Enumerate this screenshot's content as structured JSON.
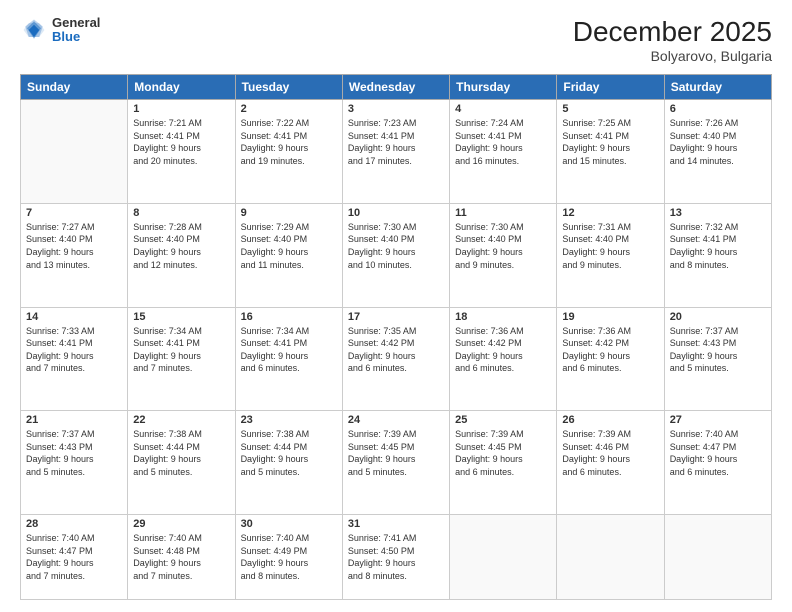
{
  "logo": {
    "line1": "General",
    "line2": "Blue"
  },
  "title": "December 2025",
  "location": "Bolyarovo, Bulgaria",
  "weekdays": [
    "Sunday",
    "Monday",
    "Tuesday",
    "Wednesday",
    "Thursday",
    "Friday",
    "Saturday"
  ],
  "weeks": [
    [
      {
        "day": "",
        "info": ""
      },
      {
        "day": "1",
        "info": "Sunrise: 7:21 AM\nSunset: 4:41 PM\nDaylight: 9 hours\nand 20 minutes."
      },
      {
        "day": "2",
        "info": "Sunrise: 7:22 AM\nSunset: 4:41 PM\nDaylight: 9 hours\nand 19 minutes."
      },
      {
        "day": "3",
        "info": "Sunrise: 7:23 AM\nSunset: 4:41 PM\nDaylight: 9 hours\nand 17 minutes."
      },
      {
        "day": "4",
        "info": "Sunrise: 7:24 AM\nSunset: 4:41 PM\nDaylight: 9 hours\nand 16 minutes."
      },
      {
        "day": "5",
        "info": "Sunrise: 7:25 AM\nSunset: 4:41 PM\nDaylight: 9 hours\nand 15 minutes."
      },
      {
        "day": "6",
        "info": "Sunrise: 7:26 AM\nSunset: 4:40 PM\nDaylight: 9 hours\nand 14 minutes."
      }
    ],
    [
      {
        "day": "7",
        "info": "Sunrise: 7:27 AM\nSunset: 4:40 PM\nDaylight: 9 hours\nand 13 minutes."
      },
      {
        "day": "8",
        "info": "Sunrise: 7:28 AM\nSunset: 4:40 PM\nDaylight: 9 hours\nand 12 minutes."
      },
      {
        "day": "9",
        "info": "Sunrise: 7:29 AM\nSunset: 4:40 PM\nDaylight: 9 hours\nand 11 minutes."
      },
      {
        "day": "10",
        "info": "Sunrise: 7:30 AM\nSunset: 4:40 PM\nDaylight: 9 hours\nand 10 minutes."
      },
      {
        "day": "11",
        "info": "Sunrise: 7:30 AM\nSunset: 4:40 PM\nDaylight: 9 hours\nand 9 minutes."
      },
      {
        "day": "12",
        "info": "Sunrise: 7:31 AM\nSunset: 4:40 PM\nDaylight: 9 hours\nand 9 minutes."
      },
      {
        "day": "13",
        "info": "Sunrise: 7:32 AM\nSunset: 4:41 PM\nDaylight: 9 hours\nand 8 minutes."
      }
    ],
    [
      {
        "day": "14",
        "info": "Sunrise: 7:33 AM\nSunset: 4:41 PM\nDaylight: 9 hours\nand 7 minutes."
      },
      {
        "day": "15",
        "info": "Sunrise: 7:34 AM\nSunset: 4:41 PM\nDaylight: 9 hours\nand 7 minutes."
      },
      {
        "day": "16",
        "info": "Sunrise: 7:34 AM\nSunset: 4:41 PM\nDaylight: 9 hours\nand 6 minutes."
      },
      {
        "day": "17",
        "info": "Sunrise: 7:35 AM\nSunset: 4:42 PM\nDaylight: 9 hours\nand 6 minutes."
      },
      {
        "day": "18",
        "info": "Sunrise: 7:36 AM\nSunset: 4:42 PM\nDaylight: 9 hours\nand 6 minutes."
      },
      {
        "day": "19",
        "info": "Sunrise: 7:36 AM\nSunset: 4:42 PM\nDaylight: 9 hours\nand 6 minutes."
      },
      {
        "day": "20",
        "info": "Sunrise: 7:37 AM\nSunset: 4:43 PM\nDaylight: 9 hours\nand 5 minutes."
      }
    ],
    [
      {
        "day": "21",
        "info": "Sunrise: 7:37 AM\nSunset: 4:43 PM\nDaylight: 9 hours\nand 5 minutes."
      },
      {
        "day": "22",
        "info": "Sunrise: 7:38 AM\nSunset: 4:44 PM\nDaylight: 9 hours\nand 5 minutes."
      },
      {
        "day": "23",
        "info": "Sunrise: 7:38 AM\nSunset: 4:44 PM\nDaylight: 9 hours\nand 5 minutes."
      },
      {
        "day": "24",
        "info": "Sunrise: 7:39 AM\nSunset: 4:45 PM\nDaylight: 9 hours\nand 5 minutes."
      },
      {
        "day": "25",
        "info": "Sunrise: 7:39 AM\nSunset: 4:45 PM\nDaylight: 9 hours\nand 6 minutes."
      },
      {
        "day": "26",
        "info": "Sunrise: 7:39 AM\nSunset: 4:46 PM\nDaylight: 9 hours\nand 6 minutes."
      },
      {
        "day": "27",
        "info": "Sunrise: 7:40 AM\nSunset: 4:47 PM\nDaylight: 9 hours\nand 6 minutes."
      }
    ],
    [
      {
        "day": "28",
        "info": "Sunrise: 7:40 AM\nSunset: 4:47 PM\nDaylight: 9 hours\nand 7 minutes."
      },
      {
        "day": "29",
        "info": "Sunrise: 7:40 AM\nSunset: 4:48 PM\nDaylight: 9 hours\nand 7 minutes."
      },
      {
        "day": "30",
        "info": "Sunrise: 7:40 AM\nSunset: 4:49 PM\nDaylight: 9 hours\nand 8 minutes."
      },
      {
        "day": "31",
        "info": "Sunrise: 7:41 AM\nSunset: 4:50 PM\nDaylight: 9 hours\nand 8 minutes."
      },
      {
        "day": "",
        "info": ""
      },
      {
        "day": "",
        "info": ""
      },
      {
        "day": "",
        "info": ""
      }
    ]
  ]
}
